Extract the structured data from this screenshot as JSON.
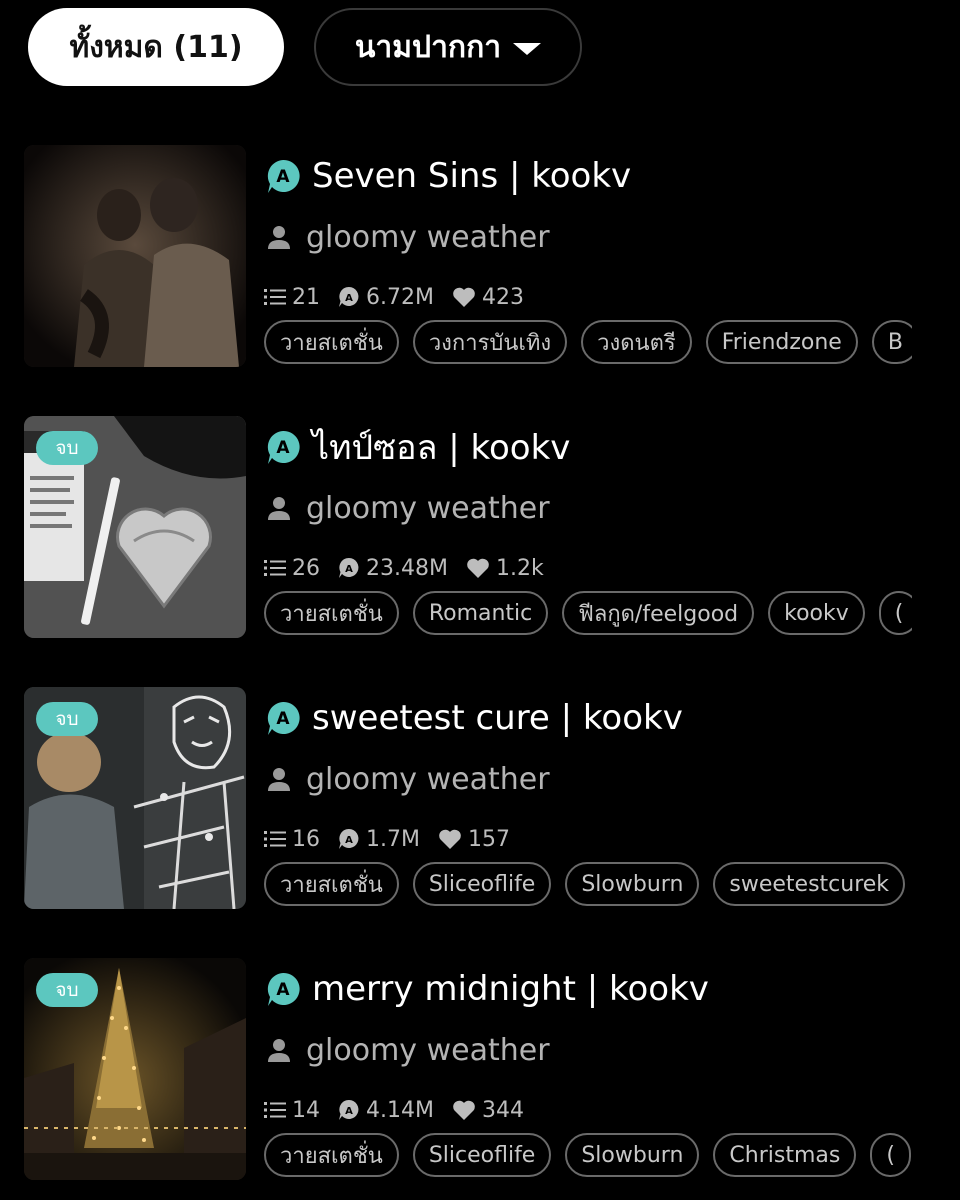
{
  "filters": {
    "all_label": "ทั้งหมด (11)",
    "pen_name_label": "นามปากกา"
  },
  "colors": {
    "accent": "#5cc7bf",
    "background": "#000000",
    "badge": "#5cc7bf"
  },
  "novels": [
    {
      "title": "Seven Sins | kookv",
      "author": "gloomy weather",
      "chapters": "21",
      "views": "6.72M",
      "likes": "423",
      "end_badge": "",
      "tags": [
        "วายสเตชั่น",
        "วงการบันเทิง",
        "วงดนตรี",
        "Friendzone",
        "B"
      ]
    },
    {
      "title": "ไทป์ซอล | kookv",
      "author": "gloomy weather",
      "chapters": "26",
      "views": "23.48M",
      "likes": "1.2k",
      "end_badge": "จบ",
      "tags": [
        "วายสเตชั่น",
        "Romantic",
        "ฟีลกูด/feelgood",
        "kookv",
        "("
      ]
    },
    {
      "title": "sweetest cure | kookv",
      "author": "gloomy weather",
      "chapters": "16",
      "views": "1.7M",
      "likes": "157",
      "end_badge": "จบ",
      "tags": [
        "วายสเตชั่น",
        "Sliceoflife",
        "Slowburn",
        "sweetestcurek"
      ]
    },
    {
      "title": "merry midnight | kookv",
      "author": "gloomy weather",
      "chapters": "14",
      "views": "4.14M",
      "likes": "344",
      "end_badge": "จบ",
      "tags": [
        "วายสเตชั่น",
        "Sliceoflife",
        "Slowburn",
        "Christmas",
        "("
      ]
    }
  ]
}
